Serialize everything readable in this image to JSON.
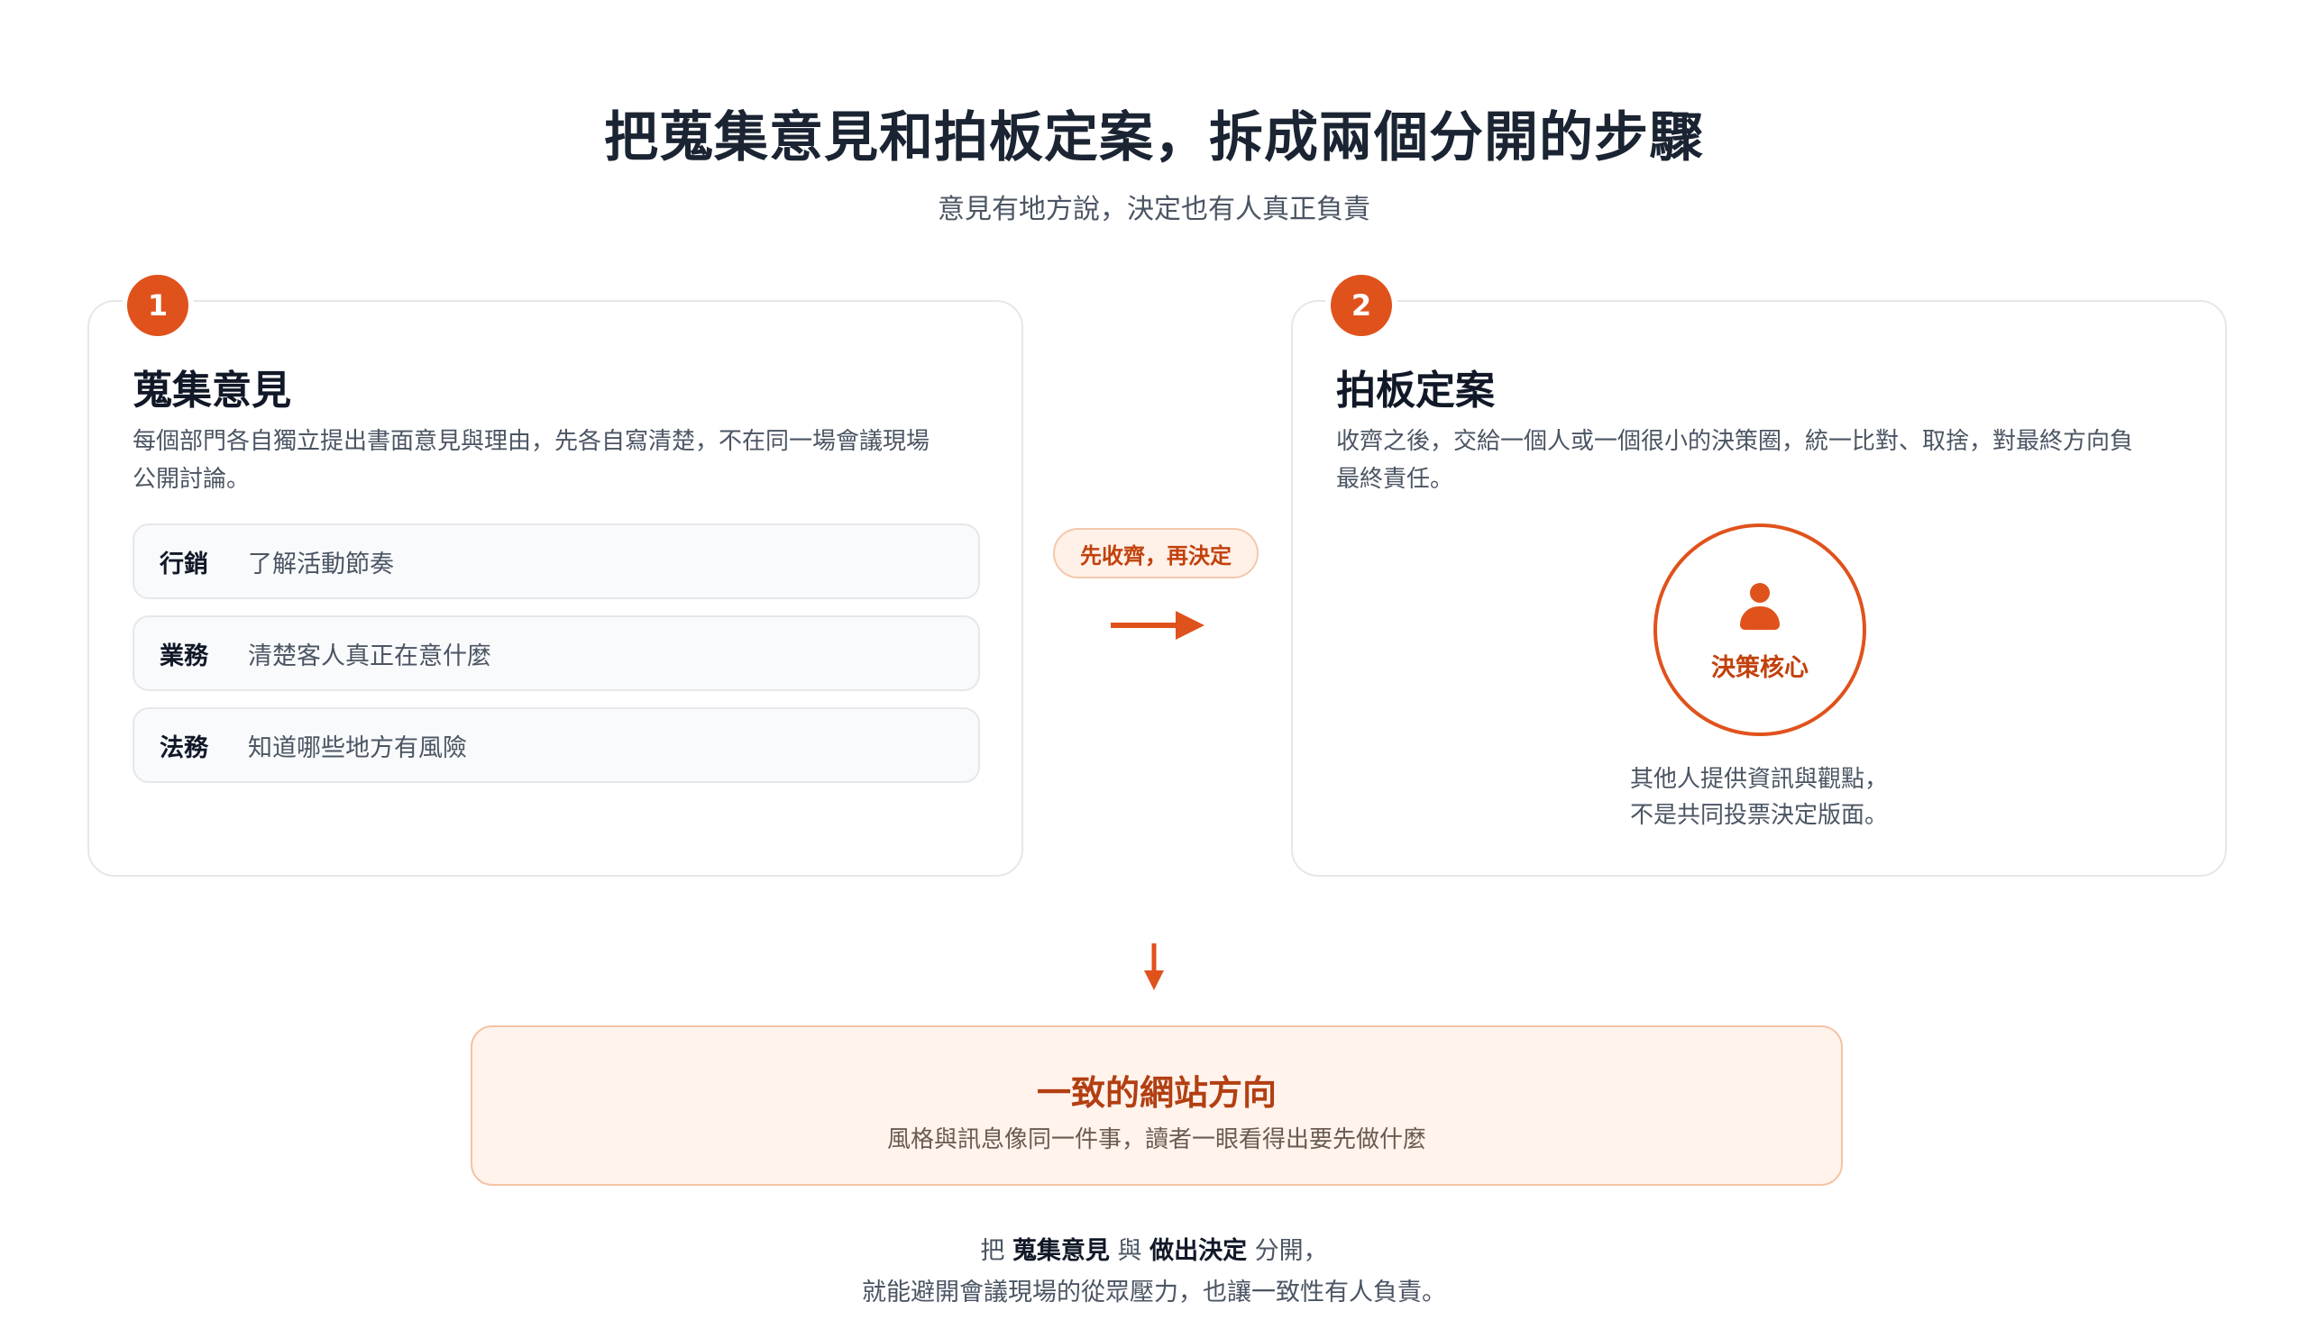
{
  "header": {
    "title": "把蒐集意見和拍板定案，拆成兩個分開的步驟",
    "subtitle": "意見有地方說，決定也有人真正負責"
  },
  "step1": {
    "number": "1",
    "title": "蒐集意見",
    "desc_line1": "每個部門各自獨立提出書面意見與理由，先各自寫清楚，不在同一場會議現場",
    "desc_line2": "公開討論。",
    "departments": [
      {
        "name": "行銷",
        "value": "了解活動節奏"
      },
      {
        "name": "業務",
        "value": "清楚客人真正在意什麼"
      },
      {
        "name": "法務",
        "value": "知道哪些地方有風險"
      }
    ]
  },
  "connector": {
    "label": "先收齊，再決定"
  },
  "step2": {
    "number": "2",
    "title": "拍板定案",
    "desc_line1": "收齊之後，交給一個人或一個很小的決策圈，統一比對、取捨，對最終方向負",
    "desc_line2": "最終責任。",
    "core_label": "決策核心",
    "note_line1": "其他人提供資訊與觀點，",
    "note_line2": "不是共同投票決定版面。"
  },
  "result": {
    "title": "一致的網站方向",
    "subtitle": "風格與訊息像同一件事，讀者一眼看得出要先做什麼"
  },
  "footer": {
    "prefix": "把 ",
    "bold1": "蒐集意見",
    "mid": " 與 ",
    "bold2": "做出決定",
    "suffix": " 分開，",
    "line2": "就能避開會議現場的從眾壓力，也讓一致性有人負責。"
  },
  "colors": {
    "accent": "#e0521c",
    "accent_dark": "#b23f12",
    "result_bg": "#fff3ec"
  }
}
